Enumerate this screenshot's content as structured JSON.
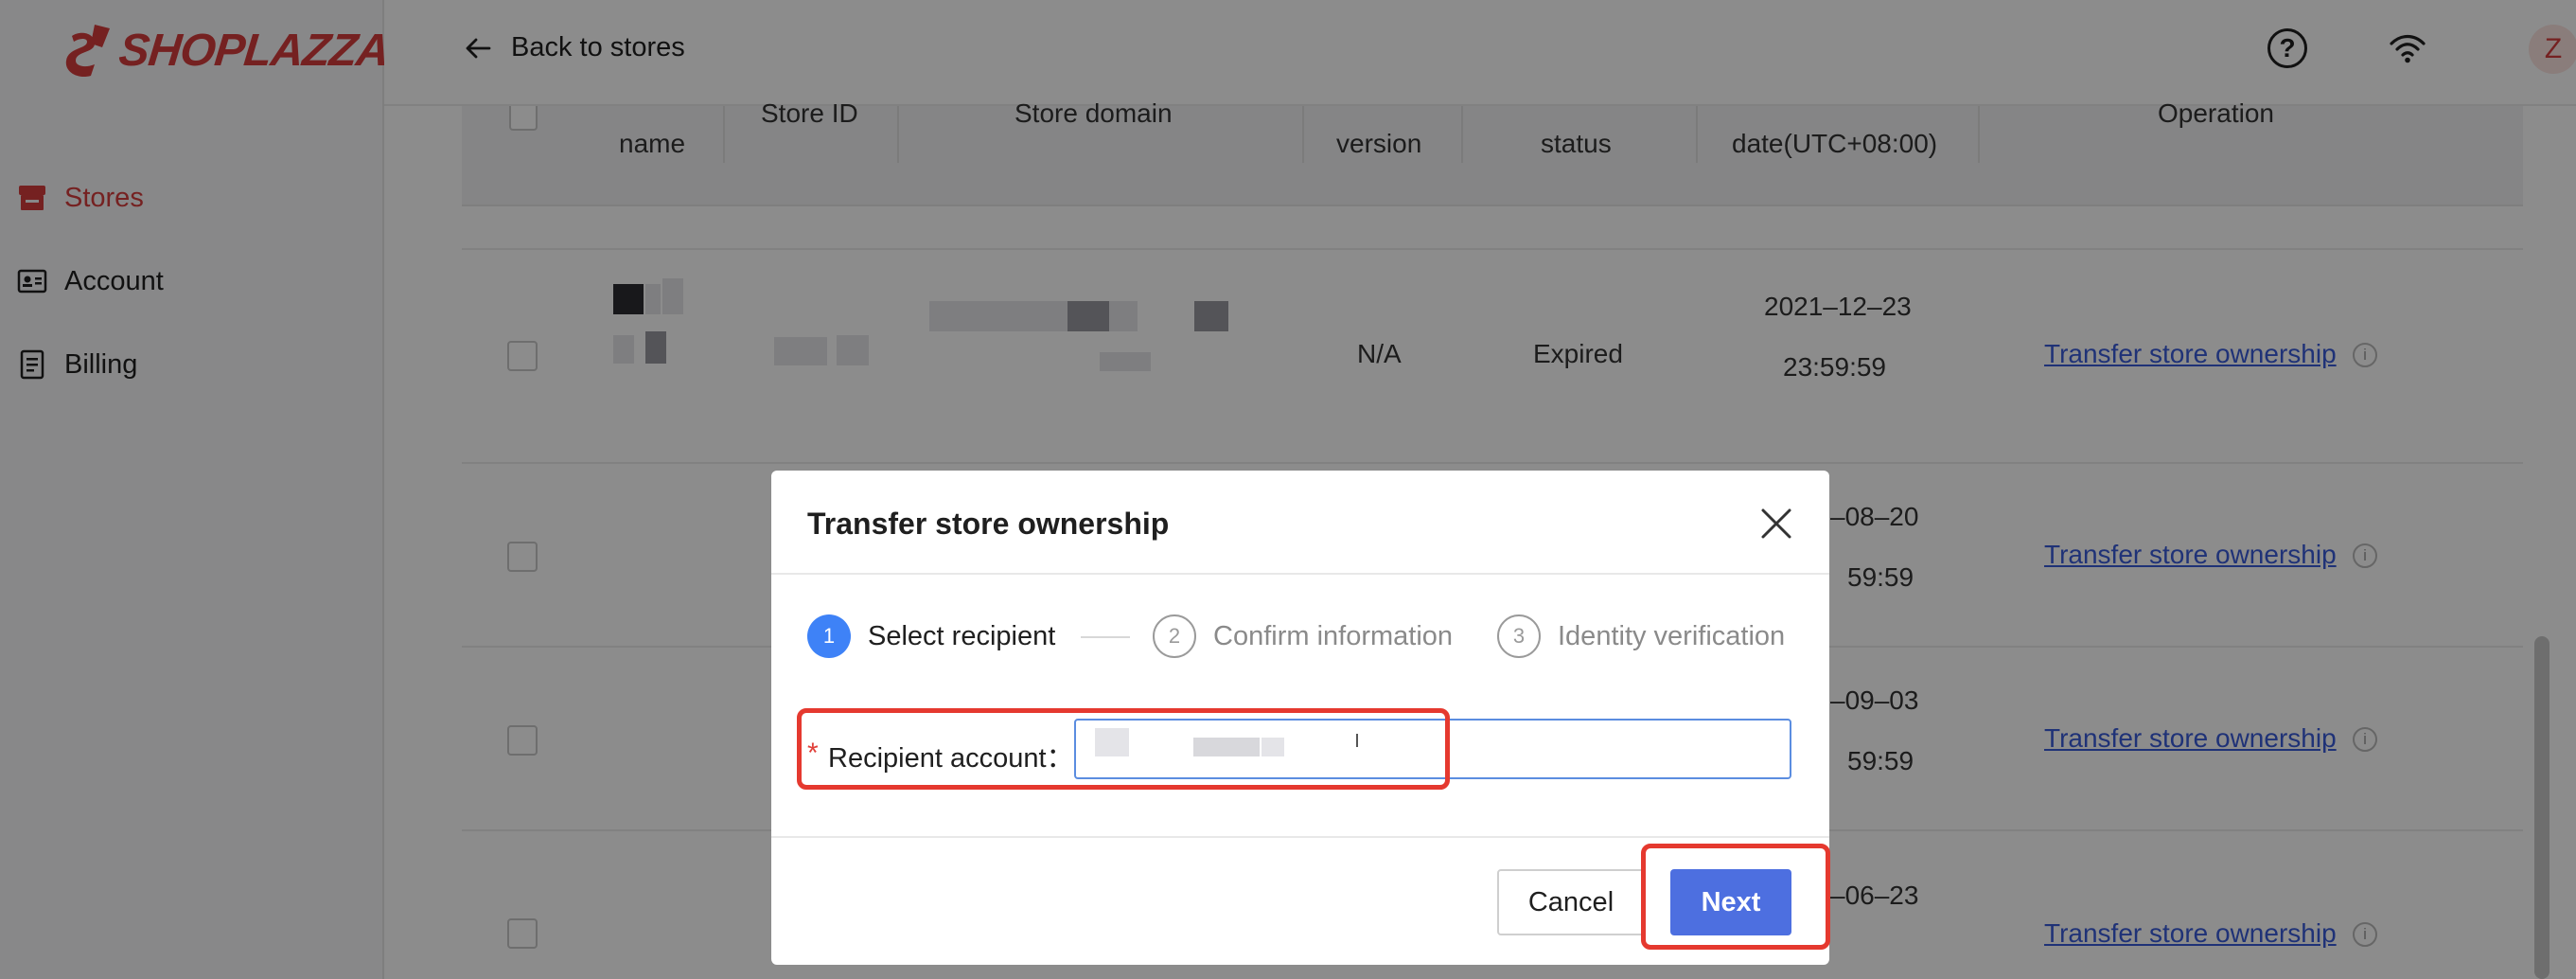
{
  "brand": {
    "name": "SHOPLAZZA",
    "color": "#d63c3c"
  },
  "sidebar": {
    "items": [
      {
        "label": "Stores",
        "icon": "store-icon",
        "active": true
      },
      {
        "label": "Account",
        "icon": "id-card-icon",
        "active": false
      },
      {
        "label": "Billing",
        "icon": "document-icon",
        "active": false
      }
    ]
  },
  "header": {
    "back_label": "Back to stores",
    "avatar_initial": "Z",
    "icons": [
      "help-circle-icon",
      "wifi-icon"
    ]
  },
  "table": {
    "columns": [
      "name",
      "Store ID",
      "Store domain",
      "version",
      "status",
      "date(UTC+08:00)",
      "Operation"
    ],
    "rows": [
      {
        "version": "N/A",
        "status": "Expired",
        "date_line1": "2021–12–23",
        "date_line2": "23:59:59",
        "operation": "Transfer store ownership"
      },
      {
        "date_line1": "–08–20",
        "date_line2": "59:59",
        "operation": "Transfer store ownership"
      },
      {
        "date_line1": "–09–03",
        "date_line2": "59:59",
        "operation": "Transfer store ownership"
      },
      {
        "date_line1": "–06–23",
        "operation": "Transfer store ownership"
      }
    ]
  },
  "modal": {
    "title": "Transfer store ownership",
    "steps": [
      {
        "num": "1",
        "label": "Select recipient",
        "state": "active"
      },
      {
        "num": "2",
        "label": "Confirm information",
        "state": "idle"
      },
      {
        "num": "3",
        "label": "Identity verification",
        "state": "idle"
      }
    ],
    "field": {
      "required_mark": "*",
      "label": "Recipient account：",
      "value": ""
    },
    "cancel_label": "Cancel",
    "next_label": "Next"
  },
  "colors": {
    "accent_blue": "#3e82f7",
    "button_blue": "#4d6fe0",
    "link_blue": "#3a5bd9",
    "highlight_red": "#e5392f"
  }
}
